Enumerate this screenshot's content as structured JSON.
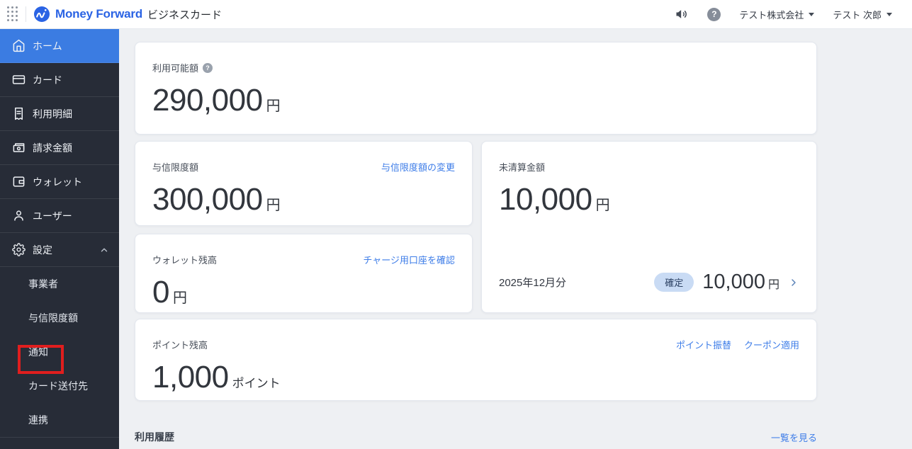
{
  "colors": {
    "brand_blue": "#2a63e4",
    "sidebar_bg": "#272c37",
    "sidebar_active_bg": "#3b7ce2",
    "link_blue": "#3e7de8",
    "badge_bg": "#c9dbf4",
    "badge_text": "#2c4163",
    "annotation_red": "#e01e1e",
    "main_bg": "#eef0f3"
  },
  "header": {
    "brand_name": "Money Forward",
    "product_name": "ビジネスカード",
    "company_menu_label": "テスト株式会社",
    "user_menu_label": "テスト 次郎",
    "help_glyph": "?"
  },
  "sidebar": {
    "items": [
      {
        "label": "ホーム",
        "icon": "home",
        "active": true
      },
      {
        "label": "カード",
        "icon": "credit-card",
        "active": false
      },
      {
        "label": "利用明細",
        "icon": "statement",
        "active": false
      },
      {
        "label": "請求金額",
        "icon": "billing",
        "active": false
      },
      {
        "label": "ウォレット",
        "icon": "wallet",
        "active": false
      },
      {
        "label": "ユーザー",
        "icon": "user",
        "active": false
      },
      {
        "label": "設定",
        "icon": "gear",
        "active": false,
        "expanded": true
      }
    ],
    "settings_subitems": [
      {
        "label": "事業者"
      },
      {
        "label": "与信限度額"
      },
      {
        "label": "通知",
        "annotated": true
      },
      {
        "label": "カード送付先"
      },
      {
        "label": "連携"
      }
    ]
  },
  "main": {
    "available_card": {
      "label": "利用可能額",
      "amount": "290,000",
      "unit": "円"
    },
    "credit_limit_card": {
      "label": "与信限度額",
      "amount": "300,000",
      "unit": "円",
      "link_label": "与信限度額の変更"
    },
    "unsettled_card": {
      "label": "未清算金額",
      "amount": "10,000",
      "unit": "円",
      "period_label": "2025年12月分",
      "status_badge": "確定",
      "period_amount": "10,000",
      "period_unit": "円"
    },
    "wallet_card": {
      "label": "ウォレット残高",
      "amount": "0",
      "unit": "円",
      "link_label": "チャージ用口座を確認"
    },
    "points_card": {
      "label": "ポイント残高",
      "amount": "1,000",
      "unit": "ポイント",
      "link_transfer": "ポイント振替",
      "link_coupon": "クーポン適用"
    },
    "history_section": {
      "title": "利用履歴",
      "link_label": "一覧を見る"
    }
  }
}
